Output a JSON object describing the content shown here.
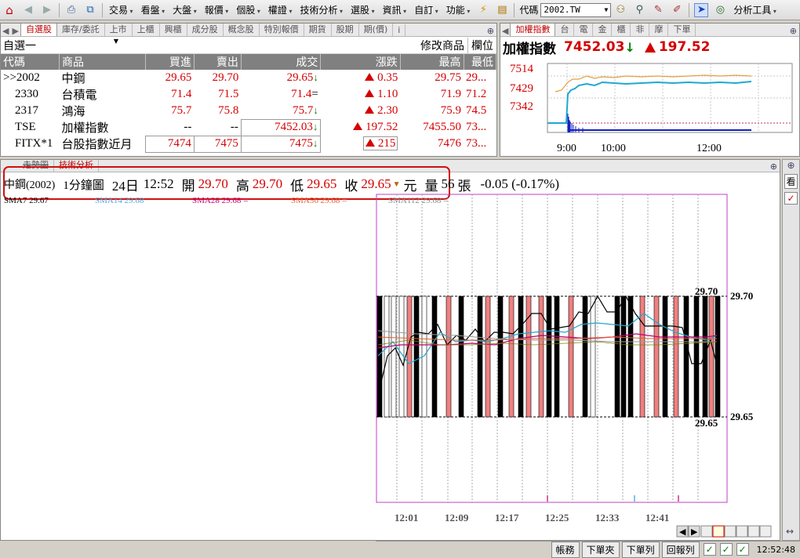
{
  "toolbar": {
    "menus": [
      "交易",
      "看盤",
      "大盤",
      "報價",
      "個股",
      "權證",
      "技術分析",
      "選股",
      "資訊",
      "自訂",
      "功能"
    ],
    "code_label": "代碼",
    "code_value": "2002.TW",
    "analysis_tools": "分析工具"
  },
  "watchlist": {
    "tabs": [
      "自選股",
      "庫存/委託",
      "上市",
      "上櫃",
      "興櫃",
      "成分股",
      "概念股",
      "特別報價",
      "期貨",
      "股期",
      "期(價)",
      "i"
    ],
    "list_name": "自選一",
    "modify_label": "修改商品",
    "fields_label": "欄位",
    "columns": [
      "代碼",
      "商品",
      "買進",
      "賣出",
      "成交",
      "漲跌",
      "最高",
      "最低"
    ],
    "rows": [
      {
        "code": ">>2002",
        "name": "中鋼",
        "bid": "29.65",
        "ask": "29.70",
        "last": "29.65",
        "last_arrow": "down",
        "change": "0.35",
        "high": "29.75",
        "low": "29..."
      },
      {
        "code": "2330",
        "name": "台積電",
        "bid": "71.4",
        "ask": "71.5",
        "last": "71.4",
        "last_arrow": "=",
        "change": "1.10",
        "high": "71.9",
        "low": "71.2"
      },
      {
        "code": "2317",
        "name": "鴻海",
        "bid": "75.7",
        "ask": "75.8",
        "last": "75.7",
        "last_arrow": "down",
        "change": "2.30",
        "high": "75.9",
        "low": "74.5"
      },
      {
        "code": "TSE",
        "name": "加權指數",
        "bid": "--",
        "ask": "--",
        "last": "7452.03",
        "last_arrow": "down",
        "change": "197.52",
        "high": "7455.50",
        "low": "73..."
      },
      {
        "code": "FITX*1",
        "name": "台股指數近月",
        "bid": "7474",
        "ask": "7475",
        "last": "7475",
        "last_arrow": "down",
        "change": "215",
        "high": "7476",
        "low": "73..."
      }
    ]
  },
  "index_panel": {
    "tabs": [
      "加權指數",
      "台",
      "電",
      "金",
      "櫃",
      "非",
      "摩",
      "下單"
    ],
    "title": "加權指數",
    "value": "7452.03",
    "change": "197.52",
    "y_ticks": [
      "7514",
      "7429",
      "7342"
    ],
    "x_ticks": [
      "9:00",
      "10:00",
      "12:00"
    ]
  },
  "chart_panel": {
    "tabs": [
      "走勢圖",
      "技術分析"
    ],
    "header": {
      "name": "中鋼(2002)",
      "period": "1分鐘圖",
      "day": "24日",
      "time": "12:52",
      "open_label": "開",
      "open": "29.70",
      "high_label": "高",
      "high": "29.70",
      "low_label": "低",
      "low": "29.65",
      "close_label": "收",
      "close": "29.65",
      "unit": "元",
      "vol_label": "量",
      "vol": "56",
      "vol_unit": "張",
      "change": "-0.05 (-0.17%)"
    },
    "sma": [
      {
        "text": "SMA7 29.67",
        "color": "#000000"
      },
      {
        "text": "SMA14 29.68",
        "color": "#4aa8d8"
      },
      {
        "text": "SMA28 29.68 =",
        "color": "#c00070"
      },
      {
        "text": "SMA56 29.68 =",
        "color": "#e06030"
      },
      {
        "text": "SMA112 29.68 =",
        "color": "#888888"
      }
    ],
    "price_labels": [
      "29.70",
      "29.65"
    ],
    "axis_prices": [
      "29.70",
      "29.65"
    ],
    "x_ticks": [
      "12:01",
      "12:09",
      "12:17",
      "12:25",
      "12:33",
      "12:41"
    ]
  },
  "side_buttons": [
    "看",
    "✓"
  ],
  "statusbar": {
    "buttons": [
      "帳務",
      "下單夾",
      "下單列",
      "回報列"
    ],
    "clock": "12:52:48"
  },
  "colors": {
    "up": "#d40000",
    "down": "#008000",
    "accent_red": "#c00000"
  }
}
